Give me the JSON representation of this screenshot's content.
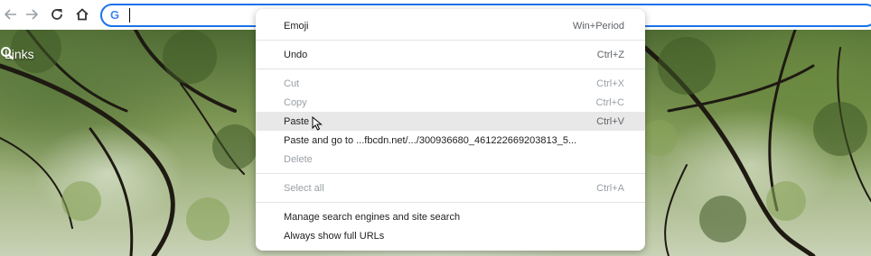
{
  "toolbar": {
    "back_icon": "back-arrow-icon",
    "forward_icon": "forward-arrow-icon",
    "reload_icon": "reload-icon",
    "home_icon": "home-icon",
    "omnibox_value": "",
    "search_engine_icon": "G"
  },
  "page": {
    "links_label": "Links",
    "search_icon": "search-icon"
  },
  "context_menu": {
    "items": [
      {
        "label": "Emoji",
        "shortcut": "Win+Period"
      },
      {
        "label": "Undo",
        "shortcut": "Ctrl+Z"
      },
      {
        "label": "Cut",
        "shortcut": "Ctrl+X",
        "disabled": true
      },
      {
        "label": "Copy",
        "shortcut": "Ctrl+C",
        "disabled": true
      },
      {
        "label": "Paste",
        "shortcut": "Ctrl+V",
        "hover": true
      },
      {
        "label": "Paste and go to ...fbcdn.net/.../300936680_461222669203813_5...",
        "shortcut": ""
      },
      {
        "label": "Delete",
        "shortcut": "",
        "disabled": true
      },
      {
        "label": "Select all",
        "shortcut": "Ctrl+A",
        "disabled": true
      },
      {
        "label": "Manage search engines and site search",
        "shortcut": ""
      },
      {
        "label": "Always show full URLs",
        "shortcut": ""
      }
    ]
  },
  "colors": {
    "omnibox_focus": "#1a73e8",
    "menu_hover": "#e8e8e8",
    "disabled_text": "#9aa0a6"
  }
}
